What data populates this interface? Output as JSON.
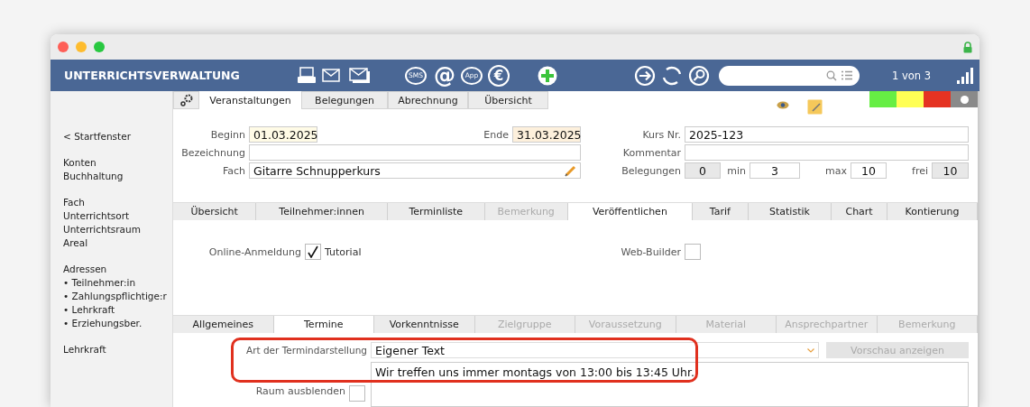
{
  "header": {
    "title": "UNTERRICHTSVERWALTUNG",
    "sms_label": "SMS",
    "at_glyph": "@",
    "app_label": "App",
    "euro_glyph": "€",
    "record_counter": "1 von 3"
  },
  "sidebar": {
    "groups": [
      {
        "items": [
          "< Startfenster"
        ]
      },
      {
        "items": [
          "Konten",
          "Buchhaltung"
        ]
      },
      {
        "items": [
          "Fach",
          "Unterrichtsort",
          "Unterrichtsraum",
          "Areal"
        ]
      },
      {
        "items": [
          "Adressen",
          "• Teilnehmer:in",
          "• Zahlungspflichtige:r",
          "• Lehrkraft",
          "• Erziehungsber."
        ]
      },
      {
        "items": [
          "Lehrkraft"
        ]
      }
    ]
  },
  "main_tabs": [
    {
      "label": "Veranstaltungen",
      "selected": true
    },
    {
      "label": "Belegungen",
      "selected": false
    },
    {
      "label": "Abrechnung",
      "selected": false
    },
    {
      "label": "Übersicht",
      "selected": false
    }
  ],
  "status_colors": [
    {
      "kind": "swatch",
      "color": "#66ee44"
    },
    {
      "kind": "swatch",
      "color": "#ffff55"
    },
    {
      "kind": "swatch",
      "color": "#e53322"
    },
    {
      "kind": "toggle",
      "color": "#8a8a8a"
    }
  ],
  "form": {
    "beginn": {
      "label": "Beginn",
      "value": "01.03.2025"
    },
    "ende": {
      "label": "Ende",
      "value": "31.03.2025"
    },
    "bezeichnung": {
      "label": "Bezeichnung"
    },
    "fach": {
      "label": "Fach",
      "value": "Gitarre Schnupperkurs"
    },
    "kurs_nr": {
      "label": "Kurs Nr.",
      "value": "2025-123"
    },
    "kommentar": {
      "label": "Kommentar"
    },
    "belegungen": {
      "label": "Belegungen",
      "value": "0"
    },
    "min": {
      "label": "min",
      "value": "3"
    },
    "max": {
      "label": "max",
      "value": "10"
    },
    "frei": {
      "label": "frei",
      "value": "10"
    }
  },
  "detail_tabs": [
    {
      "label": "Übersicht",
      "selected": false,
      "disabled": false
    },
    {
      "label": "Teilnehmer:innen",
      "selected": false,
      "disabled": false
    },
    {
      "label": "Terminliste",
      "selected": false,
      "disabled": false
    },
    {
      "label": "Bemerkung",
      "selected": false,
      "disabled": true
    },
    {
      "label": "Veröffentlichen",
      "selected": true,
      "disabled": false
    },
    {
      "label": "Tarif",
      "selected": false,
      "disabled": false
    },
    {
      "label": "Statistik",
      "selected": false,
      "disabled": false
    },
    {
      "label": "Chart",
      "selected": false,
      "disabled": false
    },
    {
      "label": "Kontierung",
      "selected": false,
      "disabled": false
    }
  ],
  "publish": {
    "online_label": "Online-Anmeldung",
    "online_checked": true,
    "tutorial_link": "Tutorial",
    "webbuilder_label": "Web-Builder",
    "webbuilder_checked": false
  },
  "sub_tabs": [
    {
      "label": "Allgemeines",
      "selected": false,
      "disabled": false
    },
    {
      "label": "Termine",
      "selected": true,
      "disabled": false
    },
    {
      "label": "Vorkenntnisse",
      "selected": false,
      "disabled": false
    },
    {
      "label": "Zielgruppe",
      "selected": false,
      "disabled": true
    },
    {
      "label": "Voraussetzung",
      "selected": false,
      "disabled": true
    },
    {
      "label": "Material",
      "selected": false,
      "disabled": true
    },
    {
      "label": "Ansprechpartner",
      "selected": false,
      "disabled": true
    },
    {
      "label": "Bemerkung",
      "selected": false,
      "disabled": true
    }
  ],
  "termine": {
    "art_label": "Art der Termindarstellung",
    "art_value": "Eigener Text",
    "preview_button": "Vorschau anzeigen",
    "preview_disabled": true,
    "text_value": "Wir treffen uns immer montags von 13:00 bis 13:45 Uhr.",
    "raum_label": "Raum ausblenden",
    "raum_checked": false,
    "highlighted": true
  }
}
